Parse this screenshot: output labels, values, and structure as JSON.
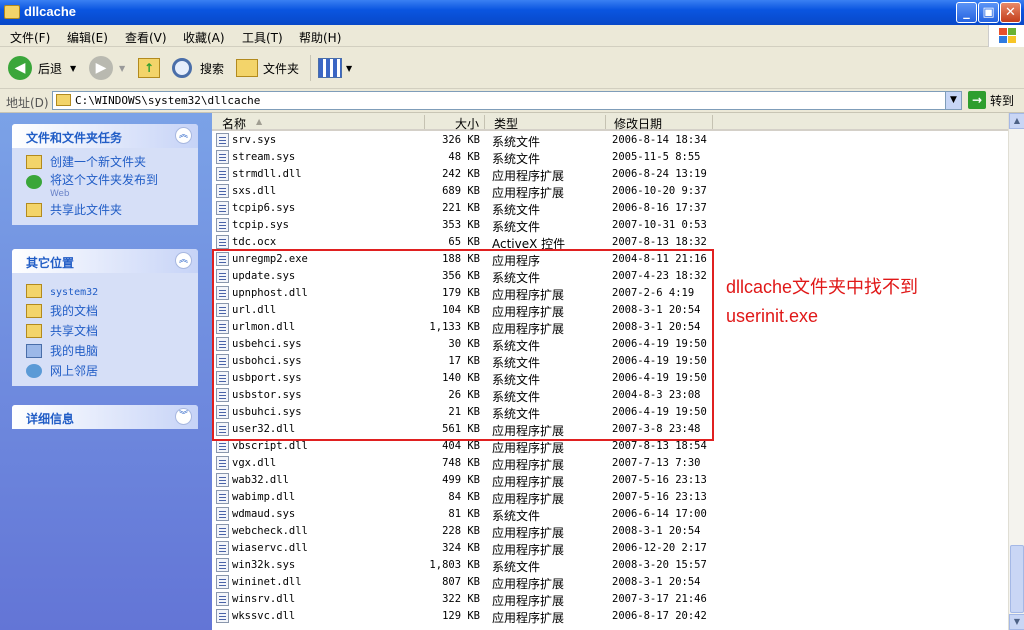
{
  "window": {
    "title": "dllcache",
    "btn_min": "_",
    "btn_max": "▣",
    "btn_close": "✕"
  },
  "menu": [
    "文件(F)",
    "编辑(E)",
    "查看(V)",
    "收藏(A)",
    "工具(T)",
    "帮助(H)"
  ],
  "toolbar": {
    "back_label": "后退",
    "search_label": "搜索",
    "folders_label": "文件夹"
  },
  "address": {
    "label": "地址(D)",
    "value": "C:\\WINDOWS\\system32\\dllcache",
    "go_label": "转到"
  },
  "tasks": {
    "title": "文件和文件夹任务",
    "items": [
      "创建一个新文件夹",
      "将这个文件夹发布到",
      "Web",
      "共享此文件夹"
    ]
  },
  "places": {
    "title": "其它位置",
    "items": [
      "system32",
      "我的文档",
      "共享文档",
      "我的电脑",
      "网上邻居"
    ]
  },
  "details": {
    "title": "详细信息"
  },
  "columns": {
    "name": "名称",
    "size": "大小",
    "type": "类型",
    "date": "修改日期"
  },
  "files": [
    {
      "name": "srv.sys",
      "size": "326 KB",
      "type": "系统文件",
      "date": "2006-8-14 18:34"
    },
    {
      "name": "stream.sys",
      "size": "48 KB",
      "type": "系统文件",
      "date": "2005-11-5 8:55"
    },
    {
      "name": "strmdll.dll",
      "size": "242 KB",
      "type": "应用程序扩展",
      "date": "2006-8-24 13:19"
    },
    {
      "name": "sxs.dll",
      "size": "689 KB",
      "type": "应用程序扩展",
      "date": "2006-10-20 9:37"
    },
    {
      "name": "tcpip6.sys",
      "size": "221 KB",
      "type": "系统文件",
      "date": "2006-8-16 17:37"
    },
    {
      "name": "tcpip.sys",
      "size": "353 KB",
      "type": "系统文件",
      "date": "2007-10-31 0:53"
    },
    {
      "name": "tdc.ocx",
      "size": "65 KB",
      "type": "ActiveX 控件",
      "date": "2007-8-13 18:32"
    },
    {
      "name": "unregmp2.exe",
      "size": "188 KB",
      "type": "应用程序",
      "date": "2004-8-11 21:16"
    },
    {
      "name": "update.sys",
      "size": "356 KB",
      "type": "系统文件",
      "date": "2007-4-23 18:32"
    },
    {
      "name": "upnphost.dll",
      "size": "179 KB",
      "type": "应用程序扩展",
      "date": "2007-2-6 4:19"
    },
    {
      "name": "url.dll",
      "size": "104 KB",
      "type": "应用程序扩展",
      "date": "2008-3-1 20:54"
    },
    {
      "name": "urlmon.dll",
      "size": "1,133 KB",
      "type": "应用程序扩展",
      "date": "2008-3-1 20:54"
    },
    {
      "name": "usbehci.sys",
      "size": "30 KB",
      "type": "系统文件",
      "date": "2006-4-19 19:50"
    },
    {
      "name": "usbohci.sys",
      "size": "17 KB",
      "type": "系统文件",
      "date": "2006-4-19 19:50"
    },
    {
      "name": "usbport.sys",
      "size": "140 KB",
      "type": "系统文件",
      "date": "2006-4-19 19:50"
    },
    {
      "name": "usbstor.sys",
      "size": "26 KB",
      "type": "系统文件",
      "date": "2004-8-3 23:08"
    },
    {
      "name": "usbuhci.sys",
      "size": "21 KB",
      "type": "系统文件",
      "date": "2006-4-19 19:50"
    },
    {
      "name": "user32.dll",
      "size": "561 KB",
      "type": "应用程序扩展",
      "date": "2007-3-8 23:48"
    },
    {
      "name": "vbscript.dll",
      "size": "404 KB",
      "type": "应用程序扩展",
      "date": "2007-8-13 18:54"
    },
    {
      "name": "vgx.dll",
      "size": "748 KB",
      "type": "应用程序扩展",
      "date": "2007-7-13 7:30"
    },
    {
      "name": "wab32.dll",
      "size": "499 KB",
      "type": "应用程序扩展",
      "date": "2007-5-16 23:13"
    },
    {
      "name": "wabimp.dll",
      "size": "84 KB",
      "type": "应用程序扩展",
      "date": "2007-5-16 23:13"
    },
    {
      "name": "wdmaud.sys",
      "size": "81 KB",
      "type": "系统文件",
      "date": "2006-6-14 17:00"
    },
    {
      "name": "webcheck.dll",
      "size": "228 KB",
      "type": "应用程序扩展",
      "date": "2008-3-1 20:54"
    },
    {
      "name": "wiaservc.dll",
      "size": "324 KB",
      "type": "应用程序扩展",
      "date": "2006-12-20 2:17"
    },
    {
      "name": "win32k.sys",
      "size": "1,803 KB",
      "type": "系统文件",
      "date": "2008-3-20 15:57"
    },
    {
      "name": "wininet.dll",
      "size": "807 KB",
      "type": "应用程序扩展",
      "date": "2008-3-1 20:54"
    },
    {
      "name": "winsrv.dll",
      "size": "322 KB",
      "type": "应用程序扩展",
      "date": "2007-3-17 21:46"
    },
    {
      "name": "wkssvc.dll",
      "size": "129 KB",
      "type": "应用程序扩展",
      "date": "2006-8-17 20:42"
    }
  ],
  "annotation": {
    "line1": "dllcache文件夹中找不到",
    "line2": "userinit.exe",
    "color": "#e01818"
  }
}
